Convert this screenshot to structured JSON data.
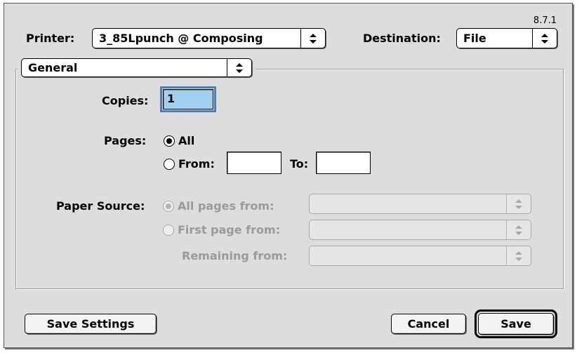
{
  "version": "8.7.1",
  "printer": {
    "label": "Printer:",
    "value": "3_85Lpunch @ Composing"
  },
  "destination": {
    "label": "Destination:",
    "value": "File"
  },
  "panel": {
    "value": "General"
  },
  "copies": {
    "label": "Copies:",
    "value": "1"
  },
  "pages": {
    "label": "Pages:",
    "all_label": "All",
    "from_label": "From:",
    "from_value": "",
    "to_label": "To:",
    "to_value": ""
  },
  "paper_source": {
    "label": "Paper Source:",
    "all_pages_label": "All pages from:",
    "first_page_label": "First page from:",
    "remaining_label": "Remaining from:",
    "all_pages_value": "",
    "first_page_value": "",
    "remaining_value": ""
  },
  "buttons": {
    "save_settings": "Save Settings",
    "cancel": "Cancel",
    "save": "Save"
  }
}
